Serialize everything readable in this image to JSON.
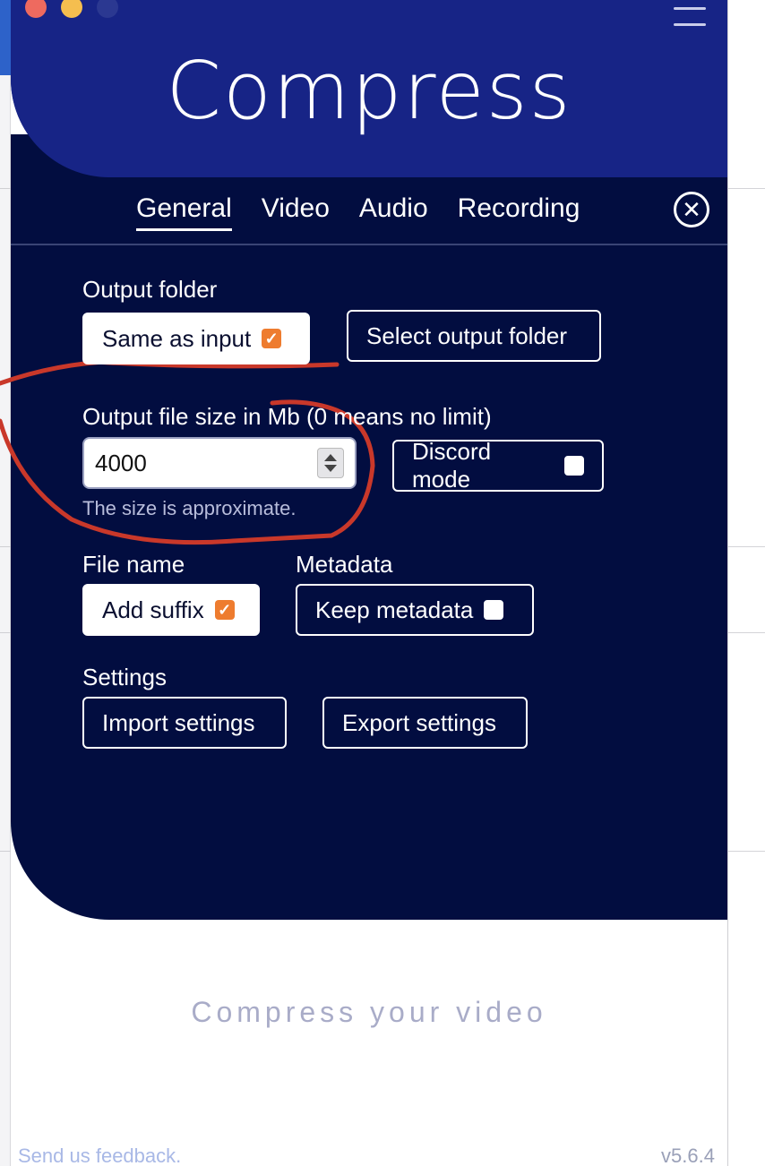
{
  "app": {
    "logo_text": "Compress"
  },
  "tabs": [
    {
      "label": "General",
      "active": true
    },
    {
      "label": "Video",
      "active": false
    },
    {
      "label": "Audio",
      "active": false
    },
    {
      "label": "Recording",
      "active": false
    }
  ],
  "general": {
    "output_folder": {
      "label": "Output folder",
      "same_as_input_label": "Same as input",
      "same_as_input_checked": true,
      "select_button_label": "Select output folder"
    },
    "file_size": {
      "label": "Output file size in Mb (0 means no limit)",
      "value": "4000",
      "hint": "The size is approximate.",
      "discord_mode_label": "Discord mode",
      "discord_mode_checked": false
    },
    "file_name": {
      "label": "File name",
      "add_suffix_label": "Add suffix",
      "add_suffix_checked": true
    },
    "metadata": {
      "label": "Metadata",
      "keep_metadata_label": "Keep metadata",
      "keep_metadata_checked": false
    },
    "settings": {
      "label": "Settings",
      "import_label": "Import settings",
      "export_label": "Export settings"
    }
  },
  "main": {
    "tagline": "Compress your video"
  },
  "footer": {
    "feedback_link": "Send us feedback.",
    "version": "v5.6.4"
  },
  "colors": {
    "header_blue": "#172486",
    "panel_navy": "#020d40",
    "checkbox_orange": "#ee7c2f",
    "annotation_red": "#c9382a"
  },
  "icons": {
    "close": "close-circle-icon",
    "menu": "hamburger-menu-icon",
    "check": "checkmark-icon"
  }
}
